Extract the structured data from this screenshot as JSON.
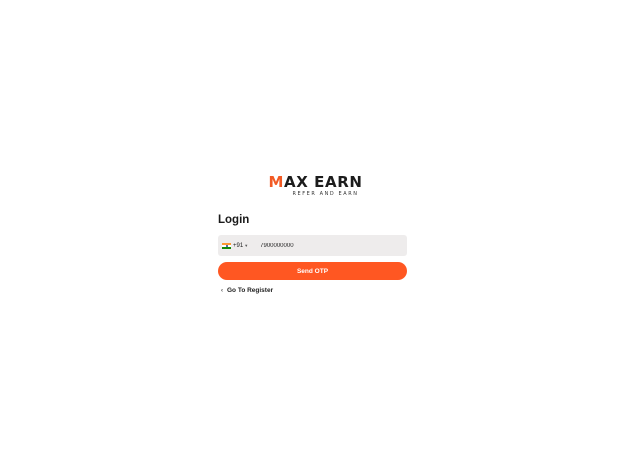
{
  "logo": {
    "accent_letter": "M",
    "rest": "AX EARN",
    "tagline": "REFER AND EARN"
  },
  "login": {
    "title": "Login",
    "country_code": "+91",
    "phone_value": "7900000000",
    "send_button_label": "Send OTP",
    "register_link_label": "Go To Register"
  },
  "colors": {
    "accent": "#ff5722",
    "field_bg": "#eeecec"
  },
  "icons": {
    "flag": "india-flag-icon",
    "caret": "chevron-down-icon",
    "back": "chevron-left-icon"
  }
}
